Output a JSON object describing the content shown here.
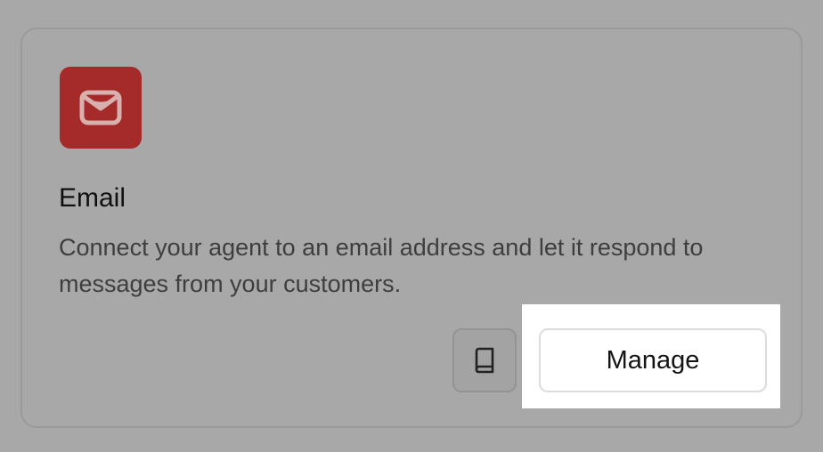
{
  "integration": {
    "icon": "mail-icon",
    "icon_color": "#a52a2a",
    "title": "Email",
    "description": "Connect your agent to an email address and let it respond to messages from your customers."
  },
  "actions": {
    "docs_icon": "book-icon",
    "manage_label": "Manage"
  }
}
